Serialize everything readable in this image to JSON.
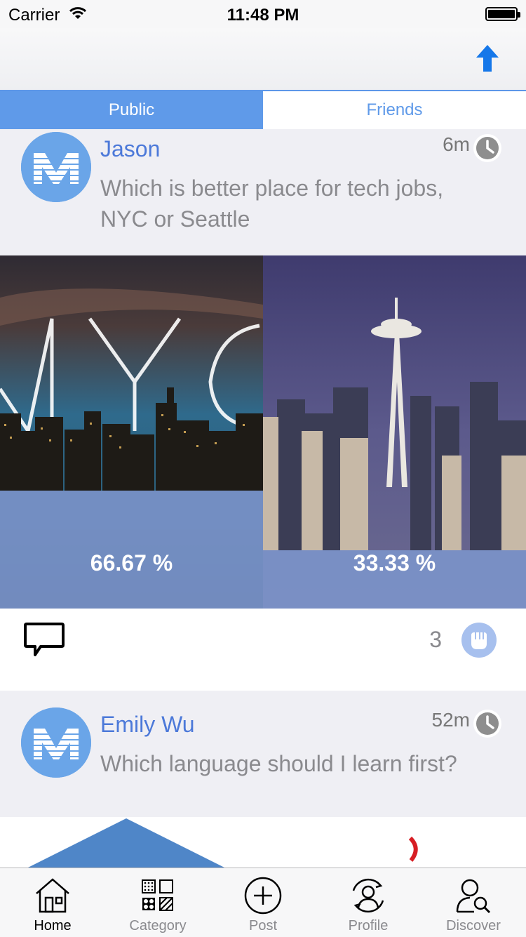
{
  "status_bar": {
    "carrier": "Carrier",
    "time": "11:48 PM"
  },
  "nav": {
    "share_icon": "arrow-up-icon"
  },
  "segments": [
    {
      "label": "Public",
      "selected": true
    },
    {
      "label": "Friends",
      "selected": false
    }
  ],
  "posts": [
    {
      "author": "Jason",
      "time_ago": "6m",
      "question": "Which is better place for tech jobs, NYC or Seattle",
      "options": [
        {
          "image": "nyc-skyline",
          "percent": "66.67 %"
        },
        {
          "image": "seattle-space-needle",
          "percent": "33.33 %"
        }
      ],
      "likes": "3"
    },
    {
      "author": "Emily Wu",
      "time_ago": "52m",
      "question": "Which language should I learn first?"
    }
  ],
  "tabs": [
    {
      "label": "Home",
      "icon": "home-icon",
      "active": true
    },
    {
      "label": "Category",
      "icon": "category-grid-icon",
      "active": false
    },
    {
      "label": "Post",
      "icon": "plus-circle-icon",
      "active": false
    },
    {
      "label": "Profile",
      "icon": "profile-icon",
      "active": false
    },
    {
      "label": "Discover",
      "icon": "discover-icon",
      "active": false
    }
  ],
  "colors": {
    "accent": "#5f9ae9",
    "author": "#4c79d9",
    "muted": "#8a8a8e"
  }
}
